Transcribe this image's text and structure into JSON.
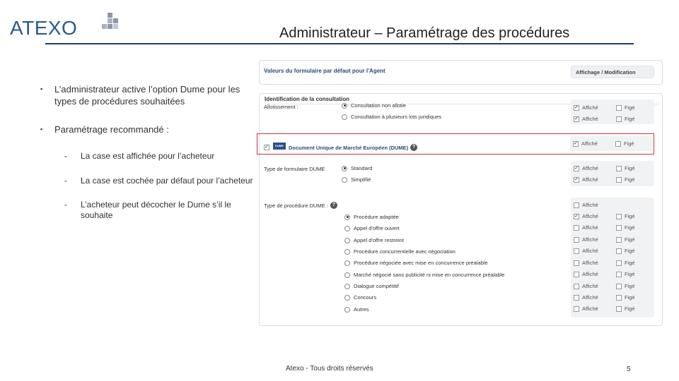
{
  "logo": {
    "text": "ATEXO"
  },
  "title": "Administrateur – Paramétrage des procédures",
  "bullets": [
    {
      "mark": "▪",
      "text": "L’administrateur active l’option Dume pour les types de procédures souhaitées"
    },
    {
      "mark": "▪",
      "text": "Paramétrage recommandé :"
    }
  ],
  "sub_bullets": [
    {
      "mark": "-",
      "text": "La case est affichée pour l’acheteur"
    },
    {
      "mark": "-",
      "text": "La case est cochée par défaut pour l’acheteur"
    },
    {
      "mark": "-",
      "text": "L’acheteur peut décocher le Dume s’il le souhaite"
    }
  ],
  "form": {
    "header": "Valeurs du formulaire par défaut pour l'Agent",
    "header_right": "Affichage / Modification",
    "section_title": "Identification de la consultation",
    "affiche": "Affiché",
    "fige": "Figé",
    "allotissement": {
      "label": "Allotissement :",
      "options": [
        "Consultation non allotie",
        "Consultation à plusieurs lots juridiques"
      ]
    },
    "dume": {
      "logo": "DUME",
      "label": "Document Unique de Marché Européen (DUME)",
      "help": "?"
    },
    "type_formulaire": {
      "label": "Type de formulaire DUME",
      "options": [
        "Standard",
        "Simplifié"
      ]
    },
    "type_procedure": {
      "label": "Type de procédure DUME :",
      "help": "?",
      "options": [
        "Procédure adaptée",
        "Appel d'offre ouvert",
        "Appel d'offre restreint",
        "Procédure concurrentielle avec négociation",
        "Procédure négociée avec mise en concurrence préalable",
        "Marché négocié sans publicité ni mise en concurrence préalable",
        "Dialogue compétitif",
        "Concours",
        "Autres"
      ]
    }
  },
  "footer": "Atexo - Tous droits réservés",
  "page_number": "5"
}
